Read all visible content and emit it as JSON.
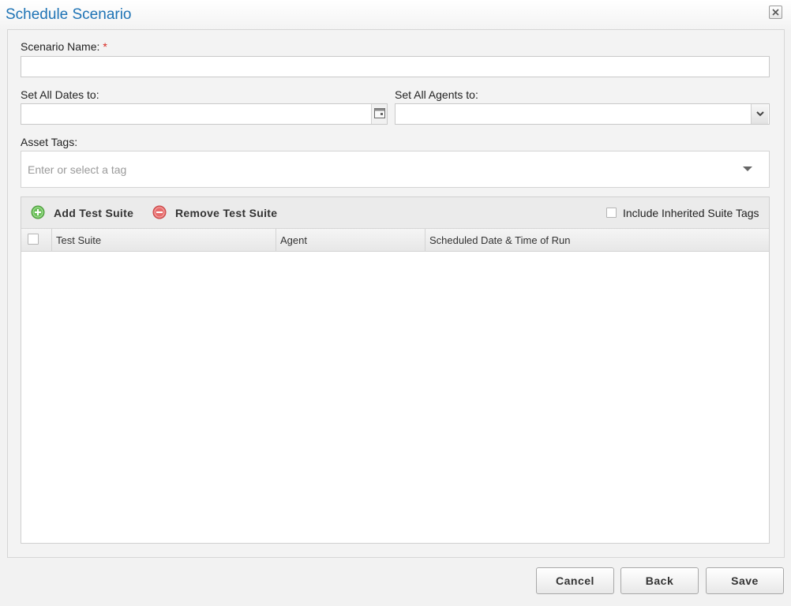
{
  "dialog": {
    "title": "Schedule Scenario",
    "close_icon": "close-icon"
  },
  "form": {
    "scenario_name": {
      "label": "Scenario Name:",
      "required_mark": "*",
      "value": ""
    },
    "set_all_dates": {
      "label": "Set All Dates to:",
      "value": "",
      "icon": "calendar-icon"
    },
    "set_all_agents": {
      "label": "Set All Agents to:",
      "value": "",
      "icon": "chevron-down-icon"
    },
    "asset_tags": {
      "label": "Asset Tags:",
      "placeholder": "Enter or select a tag",
      "icon": "caret-down-icon"
    }
  },
  "grid": {
    "toolbar": {
      "add_label": "Add Test Suite",
      "add_icon": "add-circle-icon",
      "remove_label": "Remove Test Suite",
      "remove_icon": "remove-circle-icon",
      "inherit_label": "Include Inherited Suite Tags",
      "inherit_checked": false
    },
    "columns": [
      "Test Suite",
      "Agent",
      "Scheduled Date & Time of Run"
    ],
    "rows": []
  },
  "footer": {
    "cancel_label": "Cancel",
    "back_label": "Back",
    "save_label": "Save"
  },
  "colors": {
    "title": "#1e73b5",
    "required": "#d8261f",
    "add_icon": "#5cb85c",
    "remove_icon": "#e05555"
  }
}
